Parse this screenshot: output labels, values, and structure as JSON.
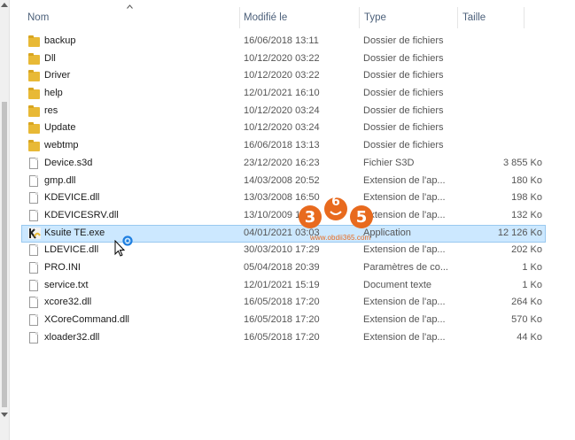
{
  "columns": {
    "name": "Nom",
    "modified": "Modifié le",
    "type": "Type",
    "size": "Taille"
  },
  "files": [
    {
      "name": "backup",
      "modified": "16/06/2018 13:11",
      "type": "Dossier de fichiers",
      "size": "",
      "icon": "folder-icon"
    },
    {
      "name": "Dll",
      "modified": "10/12/2020 03:22",
      "type": "Dossier de fichiers",
      "size": "",
      "icon": "folder-icon"
    },
    {
      "name": "Driver",
      "modified": "10/12/2020 03:22",
      "type": "Dossier de fichiers",
      "size": "",
      "icon": "folder-icon"
    },
    {
      "name": "help",
      "modified": "12/01/2021 16:10",
      "type": "Dossier de fichiers",
      "size": "",
      "icon": "folder-icon"
    },
    {
      "name": "res",
      "modified": "10/12/2020 03:24",
      "type": "Dossier de fichiers",
      "size": "",
      "icon": "folder-icon"
    },
    {
      "name": "Update",
      "modified": "10/12/2020 03:24",
      "type": "Dossier de fichiers",
      "size": "",
      "icon": "folder-icon"
    },
    {
      "name": "webtmp",
      "modified": "16/06/2018 13:13",
      "type": "Dossier de fichiers",
      "size": "",
      "icon": "folder-icon"
    },
    {
      "name": "Device.s3d",
      "modified": "23/12/2020 16:23",
      "type": "Fichier S3D",
      "size": "3 855 Ko",
      "icon": "file-icon"
    },
    {
      "name": "gmp.dll",
      "modified": "14/03/2008 20:52",
      "type": "Extension de l'ap...",
      "size": "180 Ko",
      "icon": "file-icon"
    },
    {
      "name": "KDEVICE.dll",
      "modified": "13/03/2008 16:50",
      "type": "Extension de l'ap...",
      "size": "198 Ko",
      "icon": "file-icon"
    },
    {
      "name": "KDEVICESRV.dll",
      "modified": "13/10/2009 1",
      "type": "Extension de l'ap...",
      "size": "132 Ko",
      "icon": "file-icon"
    },
    {
      "name": "Ksuite TE.exe",
      "modified": "04/01/2021 03:03",
      "type": "Application",
      "size": "12 126 Ko",
      "icon": "app-icon",
      "selected": true
    },
    {
      "name": "LDEVICE.dll",
      "modified": "30/03/2010 17:29",
      "type": "Extension de l'ap...",
      "size": "202 Ko",
      "icon": "file-icon"
    },
    {
      "name": "PRO.INI",
      "modified": "05/04/2018 20:39",
      "type": "Paramètres de co...",
      "size": "1 Ko",
      "icon": "file-icon"
    },
    {
      "name": "service.txt",
      "modified": "12/01/2021 15:19",
      "type": "Document texte",
      "size": "1 Ko",
      "icon": "file-icon"
    },
    {
      "name": "xcore32.dll",
      "modified": "16/05/2018 17:20",
      "type": "Extension de l'ap...",
      "size": "264 Ko",
      "icon": "file-icon"
    },
    {
      "name": "XCoreCommand.dll",
      "modified": "16/05/2018 17:20",
      "type": "Extension de l'ap...",
      "size": "570 Ko",
      "icon": "file-icon"
    },
    {
      "name": "xloader32.dll",
      "modified": "16/05/2018 17:20",
      "type": "Extension de l'ap...",
      "size": "44 Ko",
      "icon": "file-icon"
    }
  ],
  "watermark": {
    "digits": "365",
    "url": "www.obdii365.com"
  },
  "colors": {
    "selection": "#cce8ff",
    "selection_border": "#99c9ef",
    "folder": "#e8b936",
    "header_text": "#4c607a",
    "watermark": "#e86a1e"
  }
}
